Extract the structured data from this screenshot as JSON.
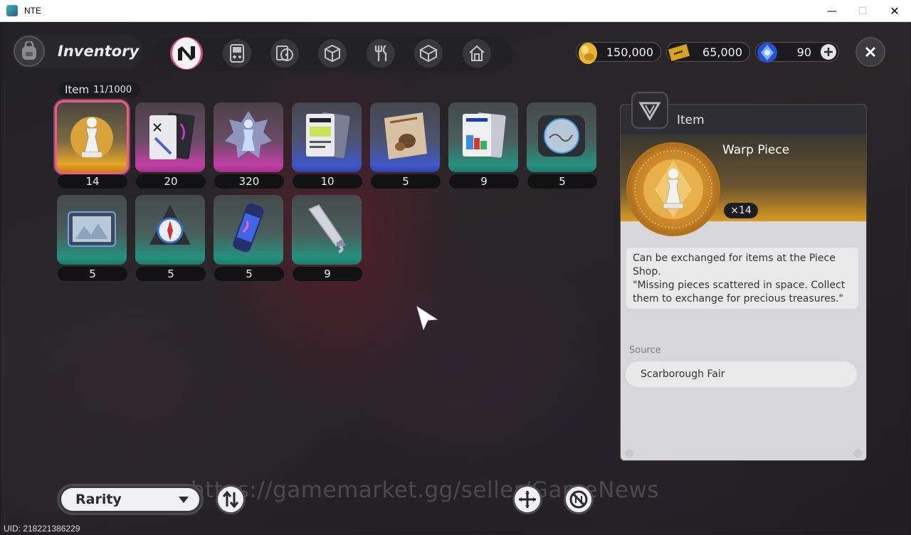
{
  "window": {
    "title": "NTE",
    "minimize_glyph": "—",
    "maximize_glyph": "☐",
    "close_glyph": "✕"
  },
  "header": {
    "title": "Inventory",
    "tabs": [
      {
        "icon": "n-logo-icon",
        "active": true
      },
      {
        "icon": "gameboy-icon",
        "active": false
      },
      {
        "icon": "discs-icon",
        "active": false
      },
      {
        "icon": "cube-icon",
        "active": false
      },
      {
        "icon": "cutlery-icon",
        "active": false
      },
      {
        "icon": "package-icon",
        "active": false
      },
      {
        "icon": "home-icon",
        "active": false
      }
    ]
  },
  "currencies": [
    {
      "icon": "gold-egg-icon",
      "value": "150,000"
    },
    {
      "icon": "ticket-icon",
      "value": "65,000"
    },
    {
      "icon": "blue-crystal-icon",
      "value": "90"
    }
  ],
  "inventory": {
    "category_label": "Item",
    "count": "11/1000",
    "items": [
      {
        "name": "Warp Piece",
        "qty": "14",
        "rarity": "gold",
        "icon": "chess-knight-icon",
        "selected": true
      },
      {
        "name": "Documents",
        "qty": "20",
        "rarity": "pink",
        "icon": "document-cards-icon",
        "selected": false
      },
      {
        "name": "Crystal Piece",
        "qty": "320",
        "rarity": "pink",
        "icon": "crystal-chess-icon",
        "selected": false
      },
      {
        "name": "Record Card",
        "qty": "10",
        "rarity": "blue",
        "icon": "id-card-icon",
        "selected": false
      },
      {
        "name": "Snack Bag",
        "qty": "5",
        "rarity": "blue",
        "icon": "snack-bag-icon",
        "selected": false
      },
      {
        "name": "Poster Stack",
        "qty": "9",
        "rarity": "teal",
        "icon": "poster-icon",
        "selected": false
      },
      {
        "name": "Turntable",
        "qty": "5",
        "rarity": "teal",
        "icon": "turntable-icon",
        "selected": false
      },
      {
        "name": "Photo Tablet",
        "qty": "5",
        "rarity": "teal",
        "icon": "tablet-icon",
        "selected": false
      },
      {
        "name": "Compass Device",
        "qty": "5",
        "rarity": "teal",
        "icon": "compass-icon",
        "selected": false
      },
      {
        "name": "Energy Can",
        "qty": "5",
        "rarity": "teal",
        "icon": "can-icon",
        "selected": false
      },
      {
        "name": "Paint Tube",
        "qty": "9",
        "rarity": "teal",
        "icon": "paint-tube-icon",
        "selected": false
      }
    ]
  },
  "detail": {
    "category": "Item",
    "name": "Warp Piece",
    "qty": "×14",
    "description_line1": "Can be exchanged for items at the Piece Shop.",
    "description_line2": "\"Missing pieces scattered in space. Collect them to exchange for precious treasures.\"",
    "source_label": "Source",
    "source": "Scarborough Fair"
  },
  "footer": {
    "sort_label": "Rarity",
    "watermark": "https://gamemarket.gg/seller/GameNews",
    "uid": "UID: 218221386229"
  },
  "colors": {
    "accent_pink": "#e0457b",
    "gold": "#e4a52a",
    "pink": "#c240a6",
    "blue": "#3f57c9",
    "teal": "#25917f"
  }
}
